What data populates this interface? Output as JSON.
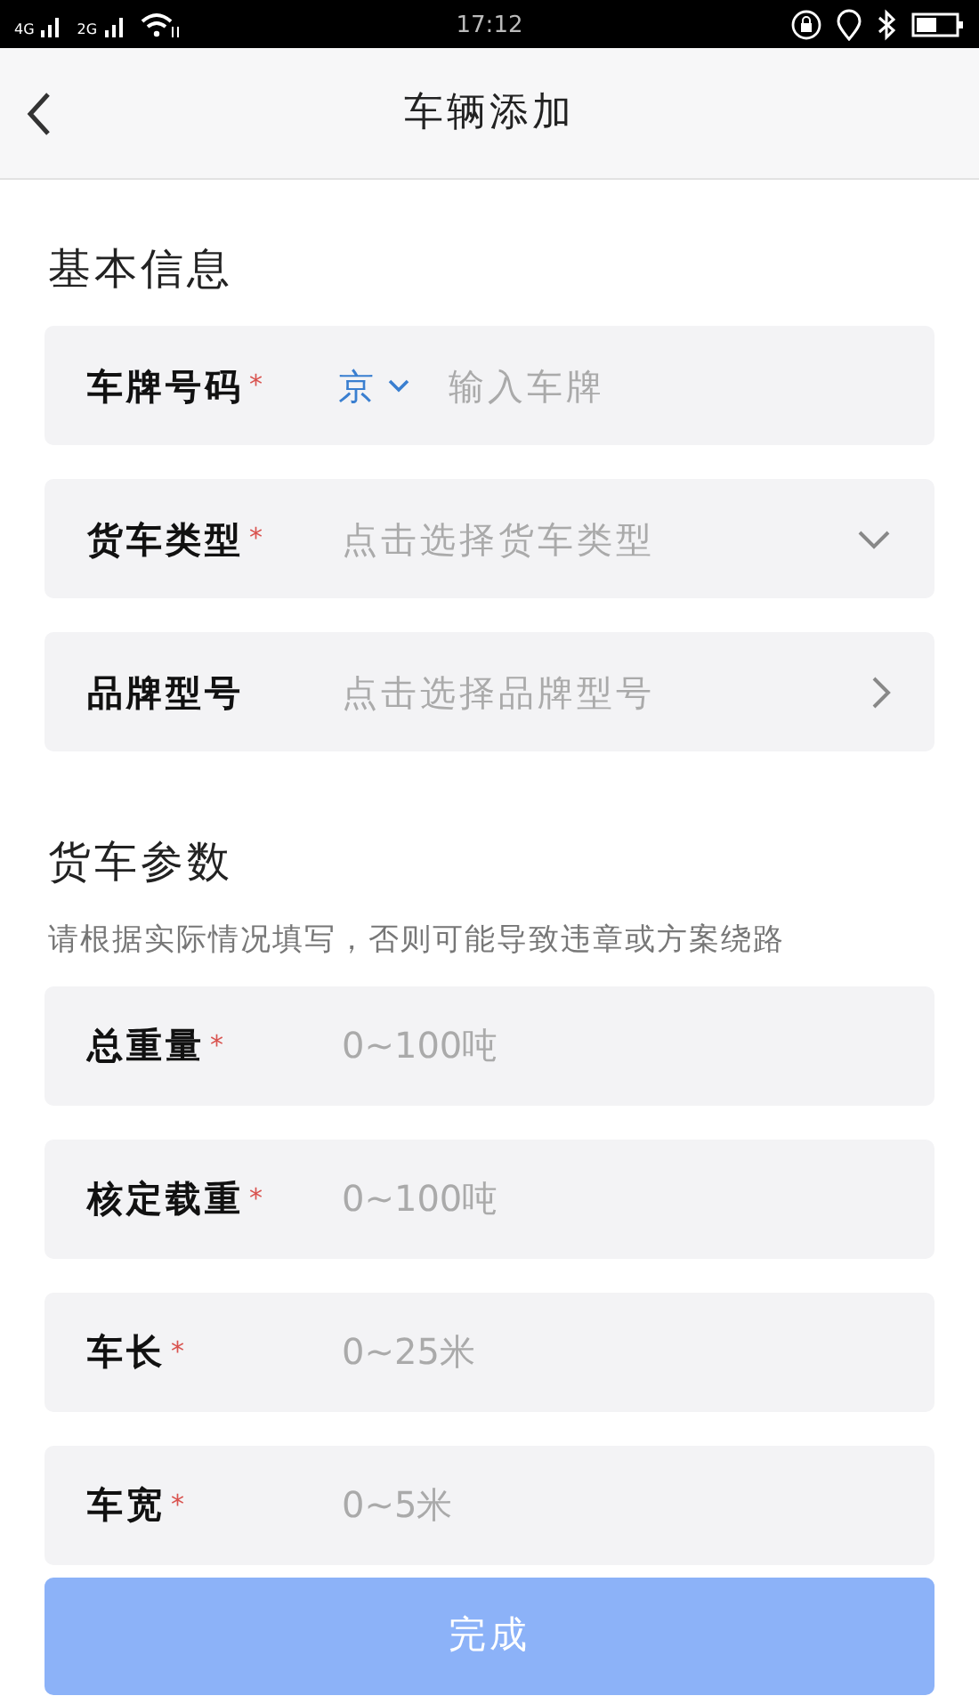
{
  "status_bar": {
    "left": [
      "4G",
      "2G"
    ],
    "time": "17:12"
  },
  "header": {
    "title": "车辆添加"
  },
  "sections": [
    {
      "title": "基本信息",
      "fields": [
        {
          "kind": "plate",
          "label": "车牌号码",
          "required_mark": "*",
          "province": "京",
          "placeholder": "输入车牌"
        },
        {
          "kind": "select",
          "label": "货车类型",
          "required_mark": "*",
          "placeholder": "点击选择货车类型"
        },
        {
          "kind": "link",
          "label": "品牌型号",
          "placeholder": "点击选择品牌型号"
        }
      ]
    },
    {
      "title": "货车参数",
      "note": "请根据实际情况填写，否则可能导致违章或方案绕路",
      "fields": [
        {
          "kind": "number",
          "label": "总重量",
          "required_mark": "*",
          "placeholder": "0~100吨"
        },
        {
          "kind": "number",
          "label": "核定载重",
          "required_mark": "*",
          "placeholder": "0~100吨"
        },
        {
          "kind": "number",
          "label": "车长",
          "required_mark": "*",
          "placeholder": "0~25米"
        },
        {
          "kind": "number",
          "label": "车宽",
          "required_mark": "*",
          "placeholder": "0~5米"
        }
      ]
    }
  ],
  "submit": {
    "label": "完成",
    "disabled": true
  }
}
